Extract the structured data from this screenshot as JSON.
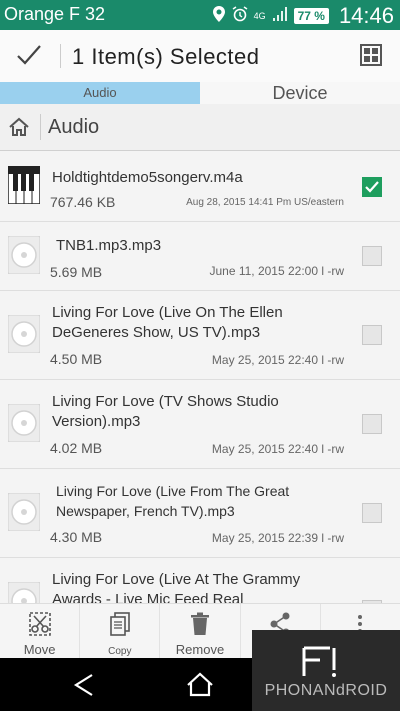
{
  "status": {
    "carrier": "Orange F 32",
    "network": "4G",
    "battery": "77 %",
    "time": "14:46"
  },
  "action_bar": {
    "title": "1 Item(s) Selected"
  },
  "tabs": [
    {
      "label": "Audio",
      "active": true
    },
    {
      "label": "Device",
      "active": false
    }
  ],
  "breadcrumb": {
    "label": "Audio"
  },
  "files": [
    {
      "name": "Holdtightdemo5songerv.m4a",
      "size": "767.46 KB",
      "date": "Aug 28, 2015 14:41 Pm US/eastern",
      "selected": true,
      "icon": "piano-icon"
    },
    {
      "name": "TNB1.mp3.mp3",
      "size": "5.69 MB",
      "date": "June 11, 2015 22:00 l -rw",
      "selected": false,
      "icon": "disc-icon"
    },
    {
      "name": "Living For Love (Live On The Ellen DeGeneres Show, US TV).mp3",
      "size": "4.50 MB",
      "date": "May 25, 2015 22:40 l -rw",
      "selected": false,
      "icon": "disc-icon"
    },
    {
      "name": "Living For Love (TV Shows Studio Version).mp3",
      "size": "4.02 MB",
      "date": "May 25, 2015 22:40 l -rw",
      "selected": false,
      "icon": "disc-icon"
    },
    {
      "name": "Living For Love (Live From The Great Newspaper, French TV).mp3",
      "size": "4.30 MB",
      "date": "May 25, 2015 22:39 l -rw",
      "selected": false,
      "icon": "disc-icon"
    },
    {
      "name": "Living For Love (Live At The Grammy Awards - Live Mic Feed Real",
      "size": "",
      "date": "",
      "selected": false,
      "icon": "disc-icon"
    }
  ],
  "toolbar": {
    "move": "Move",
    "copy": "Copy",
    "remove": "Remove"
  },
  "watermark": {
    "text": "PHONANdROID"
  },
  "colors": {
    "statusbar": "#1a8a6a",
    "tab_active": "#9ad0ee",
    "checkbox_on": "#1e9e5e"
  }
}
